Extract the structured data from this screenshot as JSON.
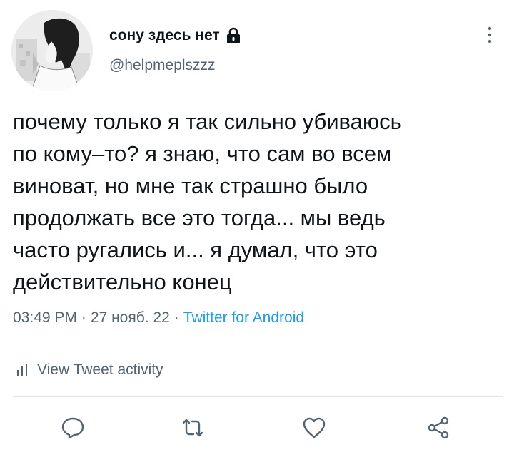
{
  "user": {
    "display_name": "сону здесь нет",
    "handle": "@helpmeplszzz",
    "protected_icon": "lock-icon"
  },
  "tweet": {
    "text": "почему только я так сильно убиваюсь\nпо кому–то? я знаю, что сам во всем\nвиноват, но мне так страшно было\nпродолжать все это тогда... мы ведь\nчасто ругались и... я думал, что это\nдействительно конец",
    "time": "03:49 PM",
    "date": "27 нояб. 22",
    "separator": "·",
    "source": "Twitter for Android"
  },
  "activity": {
    "label": "View Tweet activity",
    "icon": "bar-chart-icon"
  },
  "actions": {
    "reply_icon": "reply-icon",
    "retweet_icon": "retweet-icon",
    "like_icon": "heart-icon",
    "share_icon": "share-icon"
  },
  "colors": {
    "text": "#0f1419",
    "secondary": "#536471",
    "link": "#1d9bf0",
    "divider": "#dde3e8"
  }
}
